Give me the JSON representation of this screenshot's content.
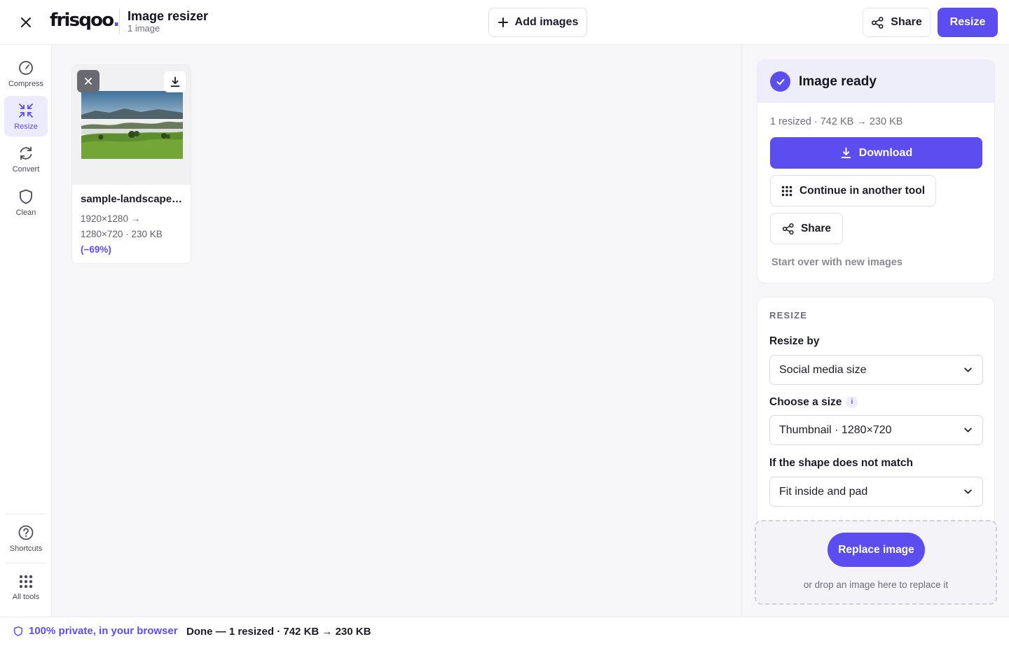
{
  "header": {
    "logo_text": "frisqoo",
    "logo_dot": ".",
    "title": "Image resizer",
    "subtitle": "1 image",
    "add_images_label": "Add images",
    "share_label": "Share",
    "resize_label": "Resize"
  },
  "rail": {
    "items": [
      {
        "label": "Compress",
        "icon": "gauge-icon",
        "active": false
      },
      {
        "label": "Resize",
        "icon": "shrink-arrows-icon",
        "active": true
      },
      {
        "label": "Convert",
        "icon": "refresh-icon",
        "active": false
      },
      {
        "label": "Clean",
        "icon": "shield-icon",
        "active": false
      }
    ],
    "bottom": [
      {
        "label": "Shortcuts",
        "icon": "help-circle-icon"
      },
      {
        "label": "All tools",
        "icon": "grid-dots-icon"
      }
    ]
  },
  "card": {
    "filename": "sample-landscape…",
    "dims_line1": "1920×1280 →",
    "dims_line2": "1280×720 · 230 KB",
    "reduction": "(−69%)"
  },
  "ready": {
    "title": "Image ready",
    "stats": "1 resized · 742 KB → 230 KB",
    "download_label": "Download",
    "continue_label": "Continue in another tool",
    "share_label": "Share",
    "start_over_label": "Start over with new images"
  },
  "settings": {
    "section_label": "RESIZE",
    "resize_by_label": "Resize by",
    "resize_by_value": "Social media size",
    "size_label": "Choose a size",
    "size_info": "i",
    "size_value": "Thumbnail · 1280×720",
    "shape_label": "If the shape does not match",
    "shape_value": "Fit inside and pad"
  },
  "drop": {
    "replace_label": "Replace image",
    "hint": "or drop an image here to replace it"
  },
  "footer": {
    "privacy": "100% private, in your browser",
    "status": "Done — 1 resized · 742 KB → 230 KB"
  },
  "colors": {
    "accent": "#5b4df0",
    "accent_soft": "#eeeefb",
    "text": "#1c1c28",
    "muted": "#6e6e7c"
  }
}
